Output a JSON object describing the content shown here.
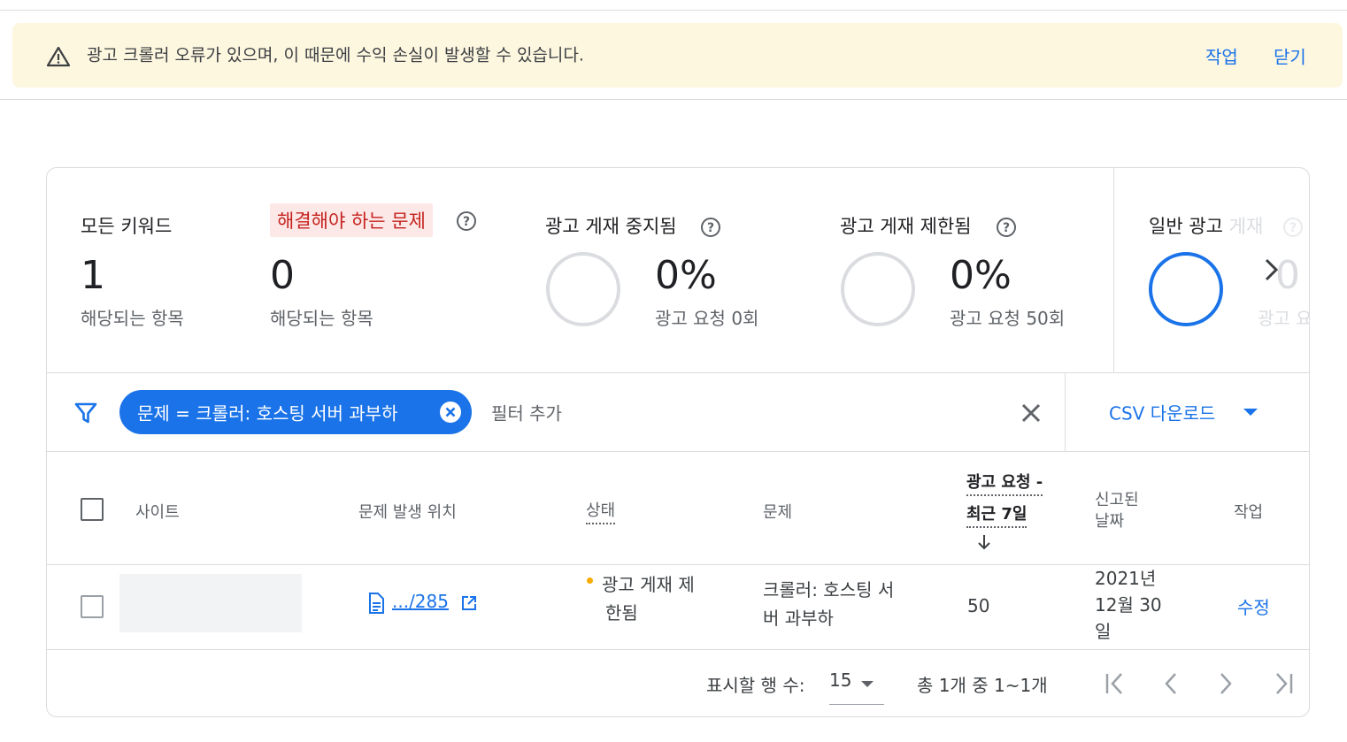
{
  "banner": {
    "message": "광고 크롤러 오류가 있으며, 이 때문에 수익 손실이 발생할 수 있습니다.",
    "action_label": "작업",
    "dismiss_label": "닫기",
    "icon": "warning-icon"
  },
  "stats": [
    {
      "title": "모든 키워드",
      "value": "1",
      "sub": "해당되는 항목"
    },
    {
      "title": "해결해야 하는 문제",
      "value": "0",
      "sub": "해당되는 항목",
      "highlighted": true
    },
    {
      "title": "광고 게재 중지됨",
      "value": "0%",
      "sub": "광고 요청 0회",
      "ring_fill": 0
    },
    {
      "title": "광고 게재 제한됨",
      "value": "0%",
      "sub": "광고 요청 50회",
      "ring_fill": 0
    },
    {
      "title": "일반 광고",
      "title_faded": "게재",
      "value": "0",
      "sub": "광고 요",
      "ring_fill": 1
    }
  ],
  "filter": {
    "chip_label": "문제 = 크롤러: 호스팅 서버 과부하",
    "add_filter_label": "필터 추가",
    "csv_label": "CSV 다운로드"
  },
  "table": {
    "headers": {
      "site": "사이트",
      "location": "문제 발생 위치",
      "status": "상태",
      "issue": "문제",
      "requests_line1": "광고 요청 -",
      "requests_line2": "최근 7일",
      "reported_line1": "신고된",
      "reported_line2": "날짜",
      "action": "작업"
    },
    "rows": [
      {
        "site": "",
        "location": ".../285",
        "status_line1": "광고 게재 제",
        "status_line2": "한됨",
        "issue_line1": "크롤러: 호스팅 서",
        "issue_line2": "버 과부하",
        "requests": "50",
        "date_line1": "2021년",
        "date_line2": "12월 30",
        "date_line3": "일",
        "action": "수정"
      }
    ]
  },
  "pagination": {
    "rows_label": "표시할 행 수:",
    "rows_value": "15",
    "range_label": "총 1개 중 1~1개"
  },
  "colors": {
    "accent": "#1a73e8",
    "warning_bg": "#fef7e0",
    "issue_highlight_bg": "#fce8e6",
    "issue_highlight_text": "#c5221f",
    "status_dot": "#f9ab00"
  }
}
